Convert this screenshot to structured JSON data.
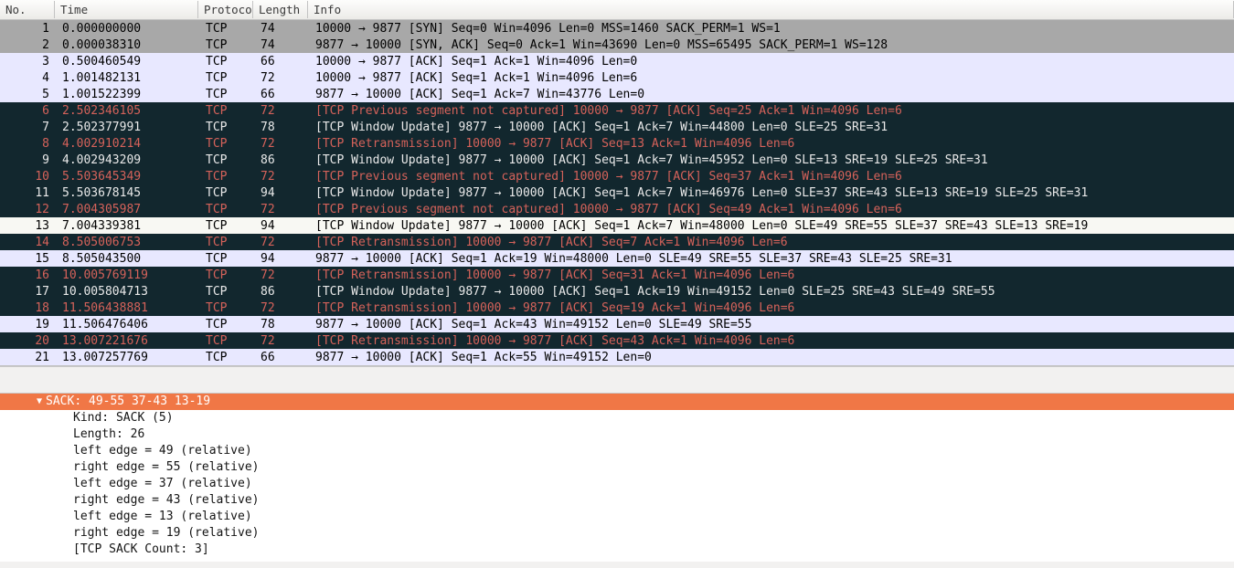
{
  "headers": {
    "no": "No.",
    "time": "Time",
    "proto": "Protoco",
    "len": "Length",
    "info": "Info"
  },
  "packets": [
    {
      "no": "1",
      "time": "0.000000000",
      "proto": "TCP",
      "len": "74",
      "info": "10000 → 9877 [SYN] Seq=0 Win=4096 Len=0 MSS=1460 SACK_PERM=1 WS=1",
      "cls": "c-gray"
    },
    {
      "no": "2",
      "time": "0.000038310",
      "proto": "TCP",
      "len": "74",
      "info": "9877 → 10000 [SYN, ACK] Seq=0 Ack=1 Win=43690 Len=0 MSS=65495 SACK_PERM=1 WS=128",
      "cls": "c-gray"
    },
    {
      "no": "3",
      "time": "0.500460549",
      "proto": "TCP",
      "len": "66",
      "info": "10000 → 9877 [ACK] Seq=1 Ack=1 Win=4096 Len=0",
      "cls": "c-default"
    },
    {
      "no": "4",
      "time": "1.001482131",
      "proto": "TCP",
      "len": "72",
      "info": "10000 → 9877 [ACK] Seq=1 Ack=1 Win=4096 Len=6",
      "cls": "c-default"
    },
    {
      "no": "5",
      "time": "1.001522399",
      "proto": "TCP",
      "len": "66",
      "info": "9877 → 10000 [ACK] Seq=1 Ack=7 Win=43776 Len=0",
      "cls": "c-default"
    },
    {
      "no": "6",
      "time": "2.502346105",
      "proto": "TCP",
      "len": "72",
      "info": "[TCP Previous segment not captured] 10000 → 9877 [ACK] Seq=25 Ack=1 Win=4096 Len=6",
      "cls": "c-error"
    },
    {
      "no": "7",
      "time": "2.502377991",
      "proto": "TCP",
      "len": "78",
      "info": "[TCP Window Update] 9877 → 10000 [ACK] Seq=1 Ack=7 Win=44800 Len=0 SLE=25 SRE=31",
      "cls": "c-dark"
    },
    {
      "no": "8",
      "time": "4.002910214",
      "proto": "TCP",
      "len": "72",
      "info": "[TCP Retransmission] 10000 → 9877 [ACK] Seq=13 Ack=1 Win=4096 Len=6",
      "cls": "c-error"
    },
    {
      "no": "9",
      "time": "4.002943209",
      "proto": "TCP",
      "len": "86",
      "info": "[TCP Window Update] 9877 → 10000 [ACK] Seq=1 Ack=7 Win=45952 Len=0 SLE=13 SRE=19 SLE=25 SRE=31",
      "cls": "c-dark"
    },
    {
      "no": "10",
      "time": "5.503645349",
      "proto": "TCP",
      "len": "72",
      "info": "[TCP Previous segment not captured] 10000 → 9877 [ACK] Seq=37 Ack=1 Win=4096 Len=6",
      "cls": "c-error"
    },
    {
      "no": "11",
      "time": "5.503678145",
      "proto": "TCP",
      "len": "94",
      "info": "[TCP Window Update] 9877 → 10000 [ACK] Seq=1 Ack=7 Win=46976 Len=0 SLE=37 SRE=43 SLE=13 SRE=19 SLE=25 SRE=31",
      "cls": "c-dark"
    },
    {
      "no": "12",
      "time": "7.004305987",
      "proto": "TCP",
      "len": "72",
      "info": "[TCP Previous segment not captured] 10000 → 9877 [ACK] Seq=49 Ack=1 Win=4096 Len=6",
      "cls": "c-error"
    },
    {
      "no": "13",
      "time": "7.004339381",
      "proto": "TCP",
      "len": "94",
      "info": "[TCP Window Update] 9877 → 10000 [ACK] Seq=1 Ack=7 Win=48000 Len=0 SLE=49 SRE=55 SLE=37 SRE=43 SLE=13 SRE=19",
      "cls": "c-light"
    },
    {
      "no": "14",
      "time": "8.505006753",
      "proto": "TCP",
      "len": "72",
      "info": "[TCP Retransmission] 10000 → 9877 [ACK] Seq=7 Ack=1 Win=4096 Len=6",
      "cls": "c-error"
    },
    {
      "no": "15",
      "time": "8.505043500",
      "proto": "TCP",
      "len": "94",
      "info": "9877 → 10000 [ACK] Seq=1 Ack=19 Win=48000 Len=0 SLE=49 SRE=55 SLE=37 SRE=43 SLE=25 SRE=31",
      "cls": "c-default"
    },
    {
      "no": "16",
      "time": "10.005769119",
      "proto": "TCP",
      "len": "72",
      "info": "[TCP Retransmission] 10000 → 9877 [ACK] Seq=31 Ack=1 Win=4096 Len=6",
      "cls": "c-error"
    },
    {
      "no": "17",
      "time": "10.005804713",
      "proto": "TCP",
      "len": "86",
      "info": "[TCP Window Update] 9877 → 10000 [ACK] Seq=1 Ack=19 Win=49152 Len=0 SLE=25 SRE=43 SLE=49 SRE=55",
      "cls": "c-dark"
    },
    {
      "no": "18",
      "time": "11.506438881",
      "proto": "TCP",
      "len": "72",
      "info": "[TCP Retransmission] 10000 → 9877 [ACK] Seq=19 Ack=1 Win=4096 Len=6",
      "cls": "c-error"
    },
    {
      "no": "19",
      "time": "11.506476406",
      "proto": "TCP",
      "len": "78",
      "info": "9877 → 10000 [ACK] Seq=1 Ack=43 Win=49152 Len=0 SLE=49 SRE=55",
      "cls": "c-default"
    },
    {
      "no": "20",
      "time": "13.007221676",
      "proto": "TCP",
      "len": "72",
      "info": "[TCP Retransmission] 10000 → 9877 [ACK] Seq=43 Ack=1 Win=4096 Len=6",
      "cls": "c-error"
    },
    {
      "no": "21",
      "time": "13.007257769",
      "proto": "TCP",
      "len": "66",
      "info": "9877 → 10000 [ACK] Seq=1 Ack=55 Win=49152 Len=0",
      "cls": "c-default"
    }
  ],
  "details": {
    "selected": "SACK: 49-55 37-43 13-19",
    "lines": [
      "Kind: SACK (5)",
      "Length: 26",
      "left edge = 49 (relative)",
      "right edge = 55 (relative)",
      "left edge = 37 (relative)",
      "right edge = 43 (relative)",
      "left edge = 13 (relative)",
      "right edge = 19 (relative)",
      "[TCP SACK Count: 3]"
    ]
  }
}
